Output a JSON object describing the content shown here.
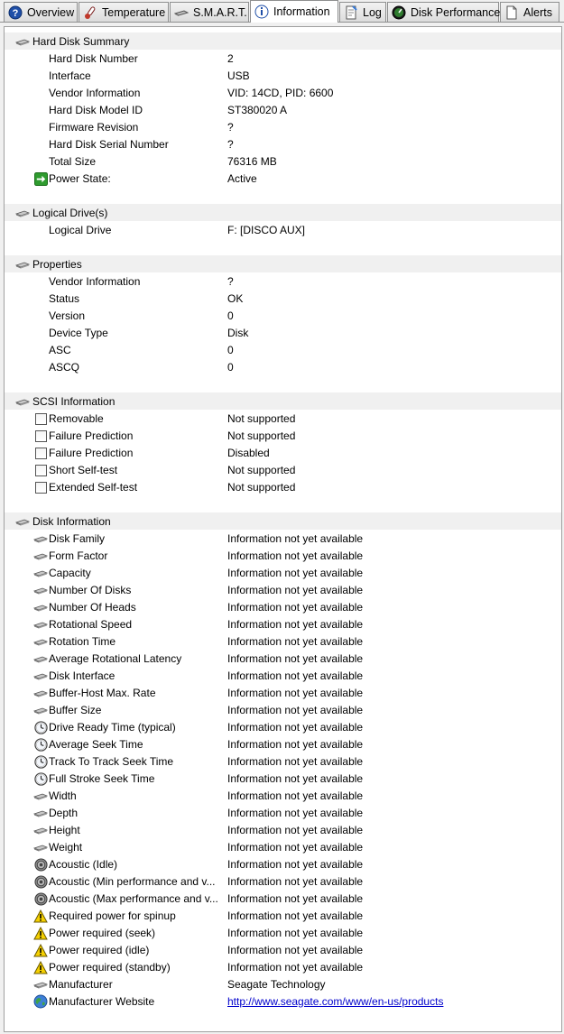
{
  "tabs": [
    {
      "label": "Overview",
      "icon": "help-circle-icon",
      "active": false
    },
    {
      "label": "Temperature",
      "icon": "thermometer-icon",
      "active": false
    },
    {
      "label": "S.M.A.R.T.",
      "icon": "disk-icon",
      "active": false
    },
    {
      "label": "Information",
      "icon": "info-icon",
      "active": true
    },
    {
      "label": "Log",
      "icon": "log-icon",
      "active": false
    },
    {
      "label": "Disk Performance",
      "icon": "gauge-icon",
      "active": false
    },
    {
      "label": "Alerts",
      "icon": "document-icon",
      "active": false
    }
  ],
  "summary": {
    "title": "Hard Disk Summary",
    "rows": [
      {
        "label": "Hard Disk Number",
        "value": "2"
      },
      {
        "label": "Interface",
        "value": "USB"
      },
      {
        "label": "Vendor Information",
        "value": "VID: 14CD, PID: 6600"
      },
      {
        "label": "Hard Disk Model ID",
        "value": "ST380020 A"
      },
      {
        "label": "Firmware Revision",
        "value": "?"
      },
      {
        "label": "Hard Disk Serial Number",
        "value": "?"
      },
      {
        "label": "Total Size",
        "value": "76316 MB"
      },
      {
        "label": "Power State:",
        "value": "Active",
        "icon": "green-arrow-icon"
      }
    ]
  },
  "logical": {
    "title": "Logical Drive(s)",
    "rows": [
      {
        "label": "Logical Drive",
        "value": "F: [DISCO AUX]"
      }
    ]
  },
  "properties": {
    "title": "Properties",
    "rows": [
      {
        "label": "Vendor Information",
        "value": "?"
      },
      {
        "label": "Status",
        "value": "OK"
      },
      {
        "label": "Version",
        "value": "0"
      },
      {
        "label": "Device Type",
        "value": "Disk"
      },
      {
        "label": "ASC",
        "value": "0"
      },
      {
        "label": "ASCQ",
        "value": "0"
      }
    ]
  },
  "scsi": {
    "title": "SCSI Information",
    "rows": [
      {
        "label": "Removable",
        "value": "Not supported",
        "icon": "checkbox"
      },
      {
        "label": "Failure Prediction",
        "value": "Not supported",
        "icon": "checkbox"
      },
      {
        "label": "Failure Prediction",
        "value": "Disabled",
        "icon": "checkbox"
      },
      {
        "label": "Short Self-test",
        "value": "Not supported",
        "icon": "checkbox"
      },
      {
        "label": "Extended Self-test",
        "value": "Not supported",
        "icon": "checkbox"
      }
    ]
  },
  "diskinfo": {
    "title": "Disk Information",
    "rows": [
      {
        "label": "Disk Family",
        "value": "Information not yet available",
        "icon": "disk-icon"
      },
      {
        "label": "Form Factor",
        "value": "Information not yet available",
        "icon": "disk-icon"
      },
      {
        "label": "Capacity",
        "value": "Information not yet available",
        "icon": "disk-icon"
      },
      {
        "label": "Number Of Disks",
        "value": "Information not yet available",
        "icon": "disk-icon"
      },
      {
        "label": "Number Of Heads",
        "value": "Information not yet available",
        "icon": "disk-icon"
      },
      {
        "label": "Rotational Speed",
        "value": "Information not yet available",
        "icon": "disk-icon"
      },
      {
        "label": "Rotation Time",
        "value": "Information not yet available",
        "icon": "disk-icon"
      },
      {
        "label": "Average Rotational Latency",
        "value": "Information not yet available",
        "icon": "disk-icon"
      },
      {
        "label": "Disk Interface",
        "value": "Information not yet available",
        "icon": "disk-icon"
      },
      {
        "label": "Buffer-Host Max. Rate",
        "value": "Information not yet available",
        "icon": "disk-icon"
      },
      {
        "label": "Buffer Size",
        "value": "Information not yet available",
        "icon": "disk-icon"
      },
      {
        "label": "Drive Ready Time (typical)",
        "value": "Information not yet available",
        "icon": "clock-icon"
      },
      {
        "label": "Average Seek Time",
        "value": "Information not yet available",
        "icon": "clock-icon"
      },
      {
        "label": "Track To Track Seek Time",
        "value": "Information not yet available",
        "icon": "clock-icon"
      },
      {
        "label": "Full Stroke Seek Time",
        "value": "Information not yet available",
        "icon": "clock-icon"
      },
      {
        "label": "Width",
        "value": "Information not yet available",
        "icon": "disk-icon"
      },
      {
        "label": "Depth",
        "value": "Information not yet available",
        "icon": "disk-icon"
      },
      {
        "label": "Height",
        "value": "Information not yet available",
        "icon": "disk-icon"
      },
      {
        "label": "Weight",
        "value": "Information not yet available",
        "icon": "disk-icon"
      },
      {
        "label": "Acoustic (Idle)",
        "value": "Information not yet available",
        "icon": "speaker-icon"
      },
      {
        "label": "Acoustic (Min performance and v...",
        "value": "Information not yet available",
        "icon": "speaker-icon"
      },
      {
        "label": "Acoustic (Max performance and v...",
        "value": "Information not yet available",
        "icon": "speaker-icon"
      },
      {
        "label": "Required power for spinup",
        "value": "Information not yet available",
        "icon": "warning-icon"
      },
      {
        "label": "Power required (seek)",
        "value": "Information not yet available",
        "icon": "warning-icon"
      },
      {
        "label": "Power required (idle)",
        "value": "Information not yet available",
        "icon": "warning-icon"
      },
      {
        "label": "Power required (standby)",
        "value": "Information not yet available",
        "icon": "warning-icon"
      },
      {
        "label": "Manufacturer",
        "value": "Seagate Technology",
        "icon": "disk-icon"
      },
      {
        "label": "Manufacturer Website",
        "value": "http://www.seagate.com/www/en-us/products",
        "icon": "globe-icon",
        "link": true
      }
    ]
  },
  "colors": {
    "link": "#0000cc",
    "section_bg": "#f0f0f0",
    "warning": "#f5d000",
    "green_arrow": "#2e9b2e"
  }
}
